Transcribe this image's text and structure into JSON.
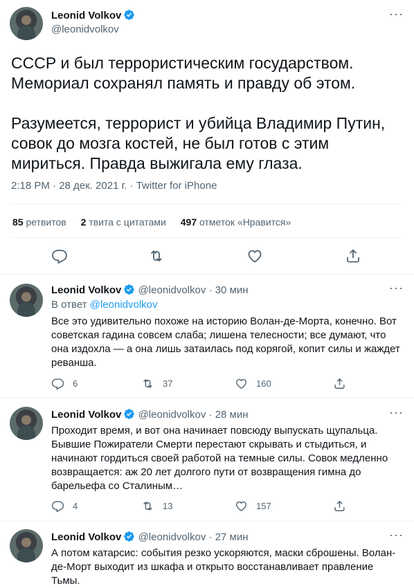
{
  "main_tweet": {
    "author_name": "Leonid Volkov",
    "handle": "@leonidvolkov",
    "text": "СССР и был террористическим государством.\nМемориал сохранял память и правду об этом.\n\nРазумеется, террорист и убийца Владимир Путин, совок до мозга костей, не был готов с этим мириться. Правда выжигала ему глаза.",
    "meta": "2:18 PM · 28 дек. 2021 г. · Twitter for iPhone",
    "stats": {
      "retweets_count": "85",
      "retweets_label": "ретвитов",
      "quotes_count": "2",
      "quotes_label": "твита с цитатами",
      "likes_count": "497",
      "likes_label": "отметок «Нравится»"
    }
  },
  "more_glyph": "···",
  "replies": [
    {
      "author_name": "Leonid Volkov",
      "handle": "@leonidvolkov",
      "time": "30 мин",
      "reply_to_prefix": "В ответ",
      "reply_to_handle": "@leonidvolkov",
      "text": "Все это удивительно похоже на историю Волан-де-Морта, конечно. Вот советская гадина совсем слаба; лишена телесности; все думают, что она издохла — а она лишь затаилась под корягой, копит силы и жаждет реванша.",
      "replies": "6",
      "retweets": "37",
      "likes": "160"
    },
    {
      "author_name": "Leonid Volkov",
      "handle": "@leonidvolkov",
      "time": "28 мин",
      "text": "Проходит время, и вот она начинает повсюду выпускать щупальца. Бывшие Пожиратели Смерти перестают скрывать и стыдиться, и начинают гордиться своей работой на темные силы. Совок медленно возвращается: аж 20 лет долгого пути от возвращения гимна до барельефа со Сталиным…",
      "replies": "4",
      "retweets": "13",
      "likes": "157"
    },
    {
      "author_name": "Leonid Volkov",
      "handle": "@leonidvolkov",
      "time": "27 мин",
      "text": "А потом катарсис: события резко ускоряются, маски сброшены. Волан-де-Морт выходит из шкафа и открыто восстанавливает правление Тьмы."
    }
  ],
  "colors": {
    "accent": "#1d9bf0",
    "text": "#0f1419",
    "secondary": "#536471",
    "divider": "#eff3f4"
  },
  "icons": [
    "verified-badge-icon",
    "more-icon",
    "reply-icon",
    "retweet-icon",
    "like-icon",
    "share-icon"
  ]
}
